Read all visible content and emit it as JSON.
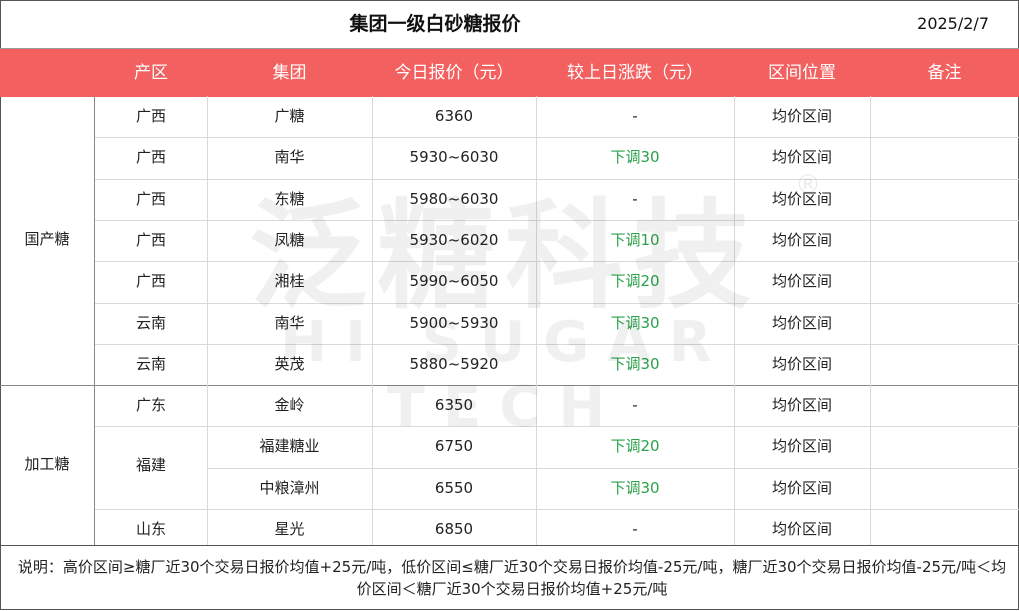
{
  "title": "集团一级白砂糖报价",
  "date": "2025/2/7",
  "columns": [
    "产区",
    "集团",
    "今日报价（元）",
    "较上日涨跌（元）",
    "区间位置",
    "备注"
  ],
  "groups": [
    {
      "label": "国产糖"
    },
    {
      "label": "加工糖"
    }
  ],
  "rows": [
    {
      "region": "广西",
      "group": "广糖",
      "price": "6360",
      "change": "-",
      "position": "均价区间",
      "note": ""
    },
    {
      "region": "广西",
      "group": "南华",
      "price": "5930~6030",
      "change": "下调30",
      "position": "均价区间",
      "note": ""
    },
    {
      "region": "广西",
      "group": "东糖",
      "price": "5980~6030",
      "change": "-",
      "position": "均价区间",
      "note": ""
    },
    {
      "region": "广西",
      "group": "凤糖",
      "price": "5930~6020",
      "change": "下调10",
      "position": "均价区间",
      "note": ""
    },
    {
      "region": "广西",
      "group": "湘桂",
      "price": "5990~6050",
      "change": "下调20",
      "position": "均价区间",
      "note": ""
    },
    {
      "region": "云南",
      "group": "南华",
      "price": "5900~5930",
      "change": "下调30",
      "position": "均价区间",
      "note": ""
    },
    {
      "region": "云南",
      "group": "英茂",
      "price": "5880~5920",
      "change": "下调30",
      "position": "均价区间",
      "note": ""
    },
    {
      "region": "广东",
      "group": "金岭",
      "price": "6350",
      "change": "-",
      "position": "均价区间",
      "note": ""
    },
    {
      "region": "福建",
      "group": "福建糖业",
      "price": "6750",
      "change": "下调20",
      "position": "均价区间",
      "note": ""
    },
    {
      "region": "",
      "group": "中粮漳州",
      "price": "6550",
      "change": "下调30",
      "position": "均价区间",
      "note": ""
    },
    {
      "region": "山东",
      "group": "星光",
      "price": "6850",
      "change": "-",
      "position": "均价区间",
      "note": ""
    }
  ],
  "footer": "说明：高价区间≥糖厂近30个交易日报价均值+25元/吨，低价区间≤糖厂近30个交易日报价均值-25元/吨，糖厂近30个交易日报价均值-25元/吨＜均价区间＜糖厂近30个交易日报价均值+25元/吨",
  "watermark": {
    "cn": "泛糖科技",
    "en": "HI SUGAR TECH",
    "reg": "®"
  },
  "colors": {
    "header_bg": "#f2605f",
    "down": "#2aa14a"
  }
}
